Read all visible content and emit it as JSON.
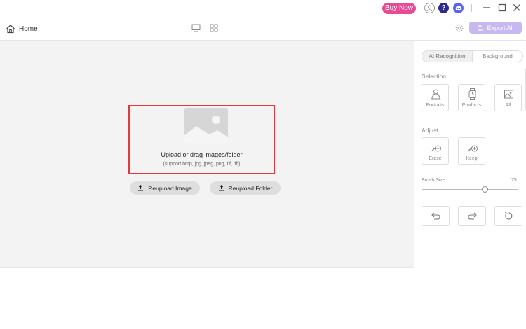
{
  "titlebar": {
    "buy_now_label": "Buy Now",
    "help_glyph": "?",
    "icons": [
      "user-icon",
      "help-icon",
      "discord-icon",
      "minimize-icon",
      "maximize-icon",
      "close-icon"
    ]
  },
  "toolbar": {
    "home_label": "Home",
    "export_label": "Export All",
    "icons": [
      "home-icon",
      "single-view-icon",
      "grid-view-icon",
      "settings-icon",
      "export-icon"
    ]
  },
  "workspace": {
    "upload_title": "Upload or drag images/folder",
    "upload_subtitle": "(support bmp,.jpg,.jpeg,.png,.tif,.tiff)",
    "reupload_image_label": "Reupload Image",
    "reupload_folder_label": "Reupload Folder"
  },
  "sidebar": {
    "tabs": [
      {
        "label": "AI Recognition",
        "active": true
      },
      {
        "label": "Background",
        "active": false
      }
    ],
    "selection_label": "Selection",
    "selection_items": [
      {
        "label": "Portraits",
        "icon": "portrait-icon"
      },
      {
        "label": "Products",
        "icon": "watch-icon"
      },
      {
        "label": "All",
        "icon": "all-icon"
      }
    ],
    "adjust_label": "Adjust",
    "adjust_items": [
      {
        "label": "Erase",
        "icon": "erase-brush-icon"
      },
      {
        "label": "Keep",
        "icon": "keep-brush-icon"
      }
    ],
    "brush_size_label": "Brush Size",
    "brush_size_value": "75",
    "history_icons": [
      "undo-icon",
      "redo-icon",
      "reset-icon"
    ]
  },
  "colors": {
    "buy_now": "#e64b96",
    "export_button": "#c8b8f2",
    "upload_border": "#e23a3a",
    "workspace_bg": "#f3f3f3",
    "help_icon": "#2e2a8c",
    "discord_icon": "#5865f2"
  }
}
